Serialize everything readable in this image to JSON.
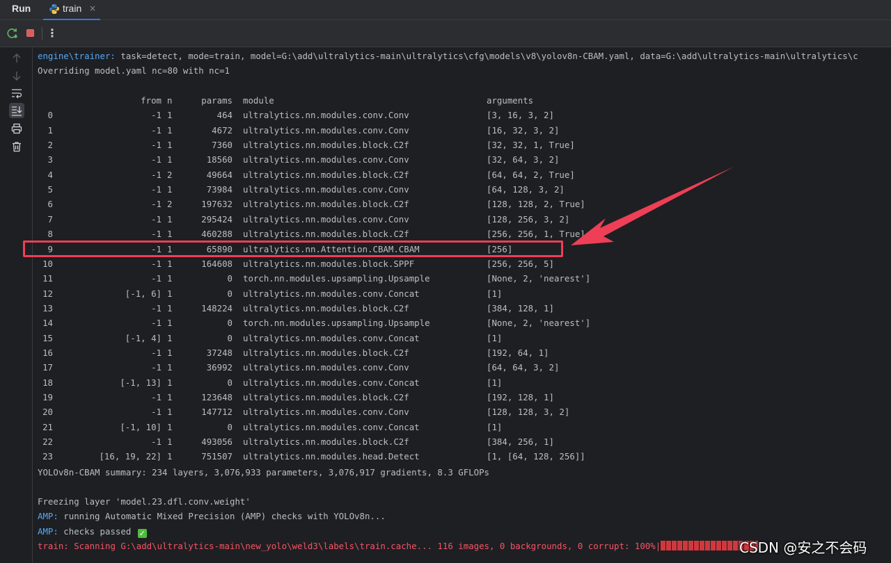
{
  "tabs": {
    "run_title": "Run",
    "active_tab": "train",
    "close_glyph": "×",
    "tab_icon": "python-icon"
  },
  "toolbar": {
    "rerun_icon": "rerun-icon",
    "stop_icon": "stop-icon",
    "more_glyph": "⋮"
  },
  "sidebar": {
    "icons": [
      "arrow-up-icon",
      "arrow-down-icon",
      "soft-wrap-icon",
      "scroll-to-end-icon",
      "print-icon",
      "trash-icon"
    ]
  },
  "console": {
    "line1_prefix": "engine\\trainer:",
    "line1_text": " task=detect, mode=train, model=G:\\add\\ultralytics-main\\ultralytics\\cfg\\models\\v8\\yolov8n-CBAM.yaml, data=G:\\add\\ultralytics-main\\ultralytics\\c",
    "line2": "Overriding model.yaml nc=80 with nc=1",
    "table_header": {
      "from": "from",
      "n": "n",
      "params": "params",
      "module": "module",
      "arguments": "arguments"
    },
    "layers": [
      {
        "idx": "0",
        "from": "-1",
        "n": "1",
        "params": "464",
        "module": "ultralytics.nn.modules.conv.Conv",
        "args": "[3, 16, 3, 2]"
      },
      {
        "idx": "1",
        "from": "-1",
        "n": "1",
        "params": "4672",
        "module": "ultralytics.nn.modules.conv.Conv",
        "args": "[16, 32, 3, 2]"
      },
      {
        "idx": "2",
        "from": "-1",
        "n": "1",
        "params": "7360",
        "module": "ultralytics.nn.modules.block.C2f",
        "args": "[32, 32, 1, True]"
      },
      {
        "idx": "3",
        "from": "-1",
        "n": "1",
        "params": "18560",
        "module": "ultralytics.nn.modules.conv.Conv",
        "args": "[32, 64, 3, 2]"
      },
      {
        "idx": "4",
        "from": "-1",
        "n": "2",
        "params": "49664",
        "module": "ultralytics.nn.modules.block.C2f",
        "args": "[64, 64, 2, True]"
      },
      {
        "idx": "5",
        "from": "-1",
        "n": "1",
        "params": "73984",
        "module": "ultralytics.nn.modules.conv.Conv",
        "args": "[64, 128, 3, 2]"
      },
      {
        "idx": "6",
        "from": "-1",
        "n": "2",
        "params": "197632",
        "module": "ultralytics.nn.modules.block.C2f",
        "args": "[128, 128, 2, True]"
      },
      {
        "idx": "7",
        "from": "-1",
        "n": "1",
        "params": "295424",
        "module": "ultralytics.nn.modules.conv.Conv",
        "args": "[128, 256, 3, 2]"
      },
      {
        "idx": "8",
        "from": "-1",
        "n": "1",
        "params": "460288",
        "module": "ultralytics.nn.modules.block.C2f",
        "args": "[256, 256, 1, True]"
      },
      {
        "idx": "9",
        "from": "-1",
        "n": "1",
        "params": "65890",
        "module": "ultralytics.nn.Attention.CBAM.CBAM",
        "args": "[256]"
      },
      {
        "idx": "10",
        "from": "-1",
        "n": "1",
        "params": "164608",
        "module": "ultralytics.nn.modules.block.SPPF",
        "args": "[256, 256, 5]"
      },
      {
        "idx": "11",
        "from": "-1",
        "n": "1",
        "params": "0",
        "module": "torch.nn.modules.upsampling.Upsample",
        "args": "[None, 2, 'nearest']"
      },
      {
        "idx": "12",
        "from": "[-1, 6]",
        "n": "1",
        "params": "0",
        "module": "ultralytics.nn.modules.conv.Concat",
        "args": "[1]"
      },
      {
        "idx": "13",
        "from": "-1",
        "n": "1",
        "params": "148224",
        "module": "ultralytics.nn.modules.block.C2f",
        "args": "[384, 128, 1]"
      },
      {
        "idx": "14",
        "from": "-1",
        "n": "1",
        "params": "0",
        "module": "torch.nn.modules.upsampling.Upsample",
        "args": "[None, 2, 'nearest']"
      },
      {
        "idx": "15",
        "from": "[-1, 4]",
        "n": "1",
        "params": "0",
        "module": "ultralytics.nn.modules.conv.Concat",
        "args": "[1]"
      },
      {
        "idx": "16",
        "from": "-1",
        "n": "1",
        "params": "37248",
        "module": "ultralytics.nn.modules.block.C2f",
        "args": "[192, 64, 1]"
      },
      {
        "idx": "17",
        "from": "-1",
        "n": "1",
        "params": "36992",
        "module": "ultralytics.nn.modules.conv.Conv",
        "args": "[64, 64, 3, 2]"
      },
      {
        "idx": "18",
        "from": "[-1, 13]",
        "n": "1",
        "params": "0",
        "module": "ultralytics.nn.modules.conv.Concat",
        "args": "[1]"
      },
      {
        "idx": "19",
        "from": "-1",
        "n": "1",
        "params": "123648",
        "module": "ultralytics.nn.modules.block.C2f",
        "args": "[192, 128, 1]"
      },
      {
        "idx": "20",
        "from": "-1",
        "n": "1",
        "params": "147712",
        "module": "ultralytics.nn.modules.conv.Conv",
        "args": "[128, 128, 3, 2]"
      },
      {
        "idx": "21",
        "from": "[-1, 10]",
        "n": "1",
        "params": "0",
        "module": "ultralytics.nn.modules.conv.Concat",
        "args": "[1]"
      },
      {
        "idx": "22",
        "from": "-1",
        "n": "1",
        "params": "493056",
        "module": "ultralytics.nn.modules.block.C2f",
        "args": "[384, 256, 1]"
      },
      {
        "idx": "23",
        "from": "[16, 19, 22]",
        "n": "1",
        "params": "751507",
        "module": "ultralytics.nn.modules.head.Detect",
        "args": "[1, [64, 128, 256]]"
      }
    ],
    "summary": "YOLOv8n-CBAM summary: 234 layers, 3,076,933 parameters, 3,076,917 gradients, 8.3 GFLOPs",
    "freeze": "Freezing layer 'model.23.dfl.conv.weight'",
    "amp1_prefix": "AMP:",
    "amp1_text": " running Automatic Mixed Precision (AMP) checks with YOLOv8n...",
    "amp2_prefix": "AMP:",
    "amp2_text": " checks passed",
    "check_glyph": "✓",
    "train_prefix": "train:",
    "train_text": " Scanning G:\\add\\ultralytics-main\\new_yolo\\weld3\\labels\\train.cache... 116 images, 0 backgrounds, 0 corrupt: 100%|",
    "train_progress": 1.0
  },
  "highlighted_layer_index": 9,
  "watermark": "CSDN @安之不会码",
  "colors": {
    "background": "#1e1f22",
    "panel": "#2b2d30",
    "text": "#bcbec4",
    "prefix_blue": "#56a8f5",
    "prefix_red": "#f75464",
    "annotation_red": "#ee3f56",
    "accent": "#3574f0"
  }
}
